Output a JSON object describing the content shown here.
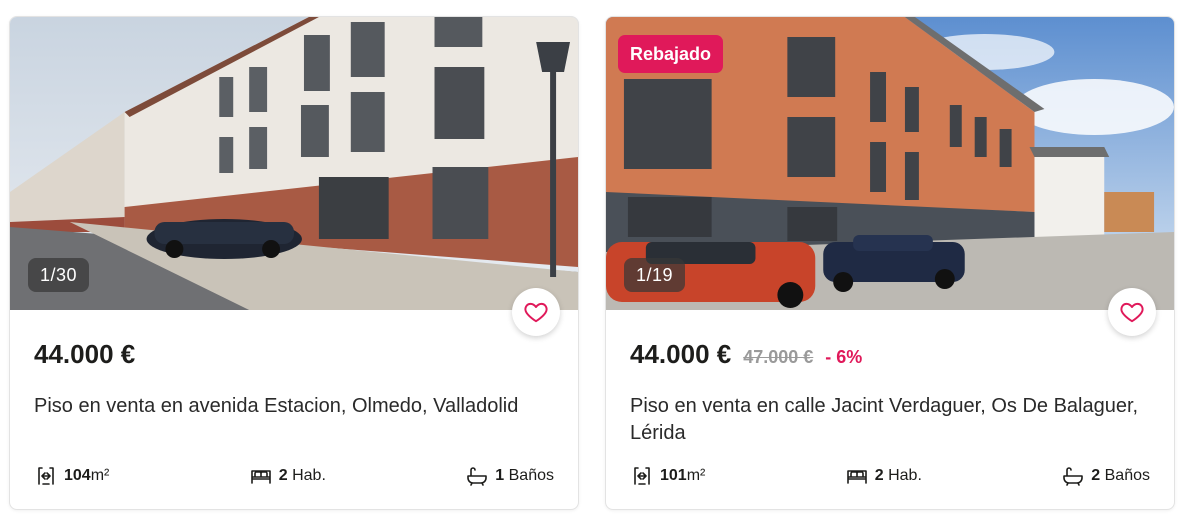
{
  "theme": {
    "accent": "#e0195a",
    "text": "#1d1d1b",
    "muted": "#9a9a9a"
  },
  "listings": [
    {
      "photo_counter": "1/30",
      "price": "44.000 €",
      "title": "Piso en venta en avenida Estacion, Olmedo, Valladolid",
      "features": {
        "area_value": "104",
        "area_unit": "m²",
        "rooms_value": "2",
        "rooms_unit": "Hab.",
        "baths_value": "1",
        "baths_unit": "Baños"
      },
      "icons": [
        "area-icon",
        "bed-icon",
        "bathtub-icon",
        "heart-icon"
      ]
    },
    {
      "tag": "Rebajado",
      "photo_counter": "1/19",
      "price": "44.000 €",
      "old_price": "47.000 €",
      "discount": "- 6%",
      "title": "Piso en venta en calle Jacint Verdaguer, Os De Balaguer, Lérida",
      "features": {
        "area_value": "101",
        "area_unit": "m²",
        "rooms_value": "2",
        "rooms_unit": "Hab.",
        "baths_value": "2",
        "baths_unit": "Baños"
      },
      "icons": [
        "area-icon",
        "bed-icon",
        "bathtub-icon",
        "heart-icon"
      ]
    }
  ]
}
